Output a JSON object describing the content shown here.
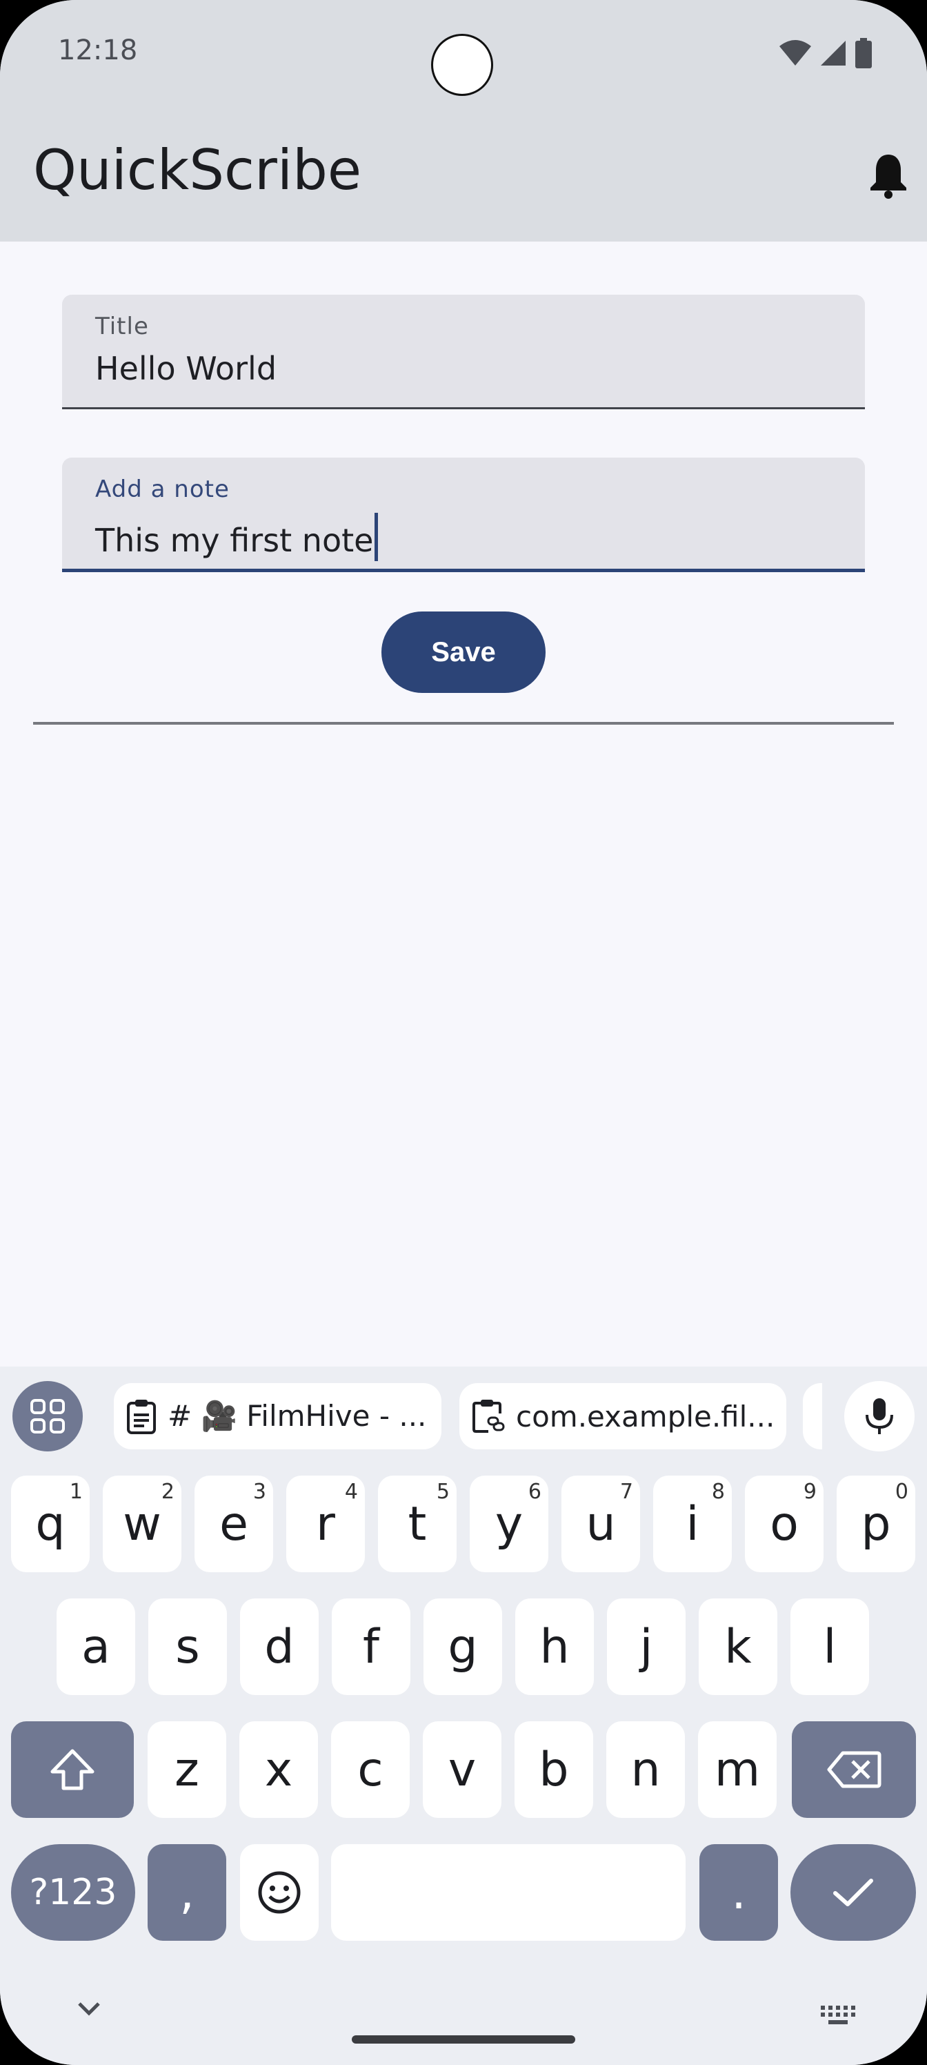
{
  "status_bar": {
    "time": "12:18"
  },
  "app_bar": {
    "title": "QuickScribe"
  },
  "form": {
    "title_label": "Title",
    "title_value": "Hello World",
    "note_label": "Add a note",
    "note_value": "This my first note",
    "save_label": "Save"
  },
  "keyboard": {
    "suggestions": [
      {
        "text": "# 🎥 FilmHive - ..."
      },
      {
        "text": "com.example.fil..."
      }
    ],
    "row1": [
      {
        "k": "q",
        "n": "1"
      },
      {
        "k": "w",
        "n": "2"
      },
      {
        "k": "e",
        "n": "3"
      },
      {
        "k": "r",
        "n": "4"
      },
      {
        "k": "t",
        "n": "5"
      },
      {
        "k": "y",
        "n": "6"
      },
      {
        "k": "u",
        "n": "7"
      },
      {
        "k": "i",
        "n": "8"
      },
      {
        "k": "o",
        "n": "9"
      },
      {
        "k": "p",
        "n": "0"
      }
    ],
    "row2": [
      "a",
      "s",
      "d",
      "f",
      "g",
      "h",
      "j",
      "k",
      "l"
    ],
    "row3": [
      "z",
      "x",
      "c",
      "v",
      "b",
      "n",
      "m"
    ],
    "symbols_label": "?123",
    "comma_label": ",",
    "period_label": "."
  },
  "colors": {
    "primary": "#2c4477",
    "app_bar_bg": "#dadde2",
    "surface": "#f7f7fc",
    "field_bg": "#e3e3e9",
    "key_dark": "#707892"
  }
}
